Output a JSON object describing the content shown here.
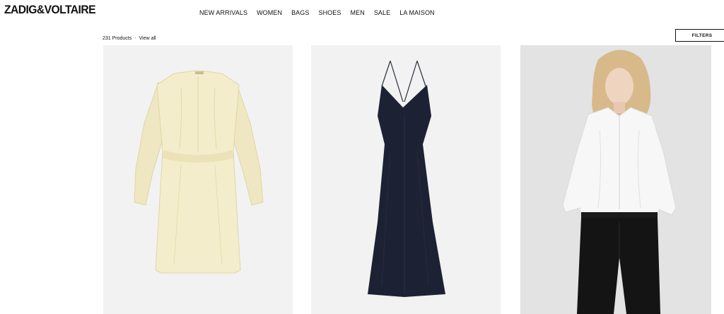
{
  "brand": {
    "logo": "ZADIG&VOLTAIRE"
  },
  "nav": {
    "items": [
      "NEW ARRIVALS",
      "WOMEN",
      "BAGS",
      "SHOES",
      "MEN",
      "SALE",
      "LA MAISON"
    ]
  },
  "listing": {
    "count_label": "231 Products",
    "separator": "-",
    "view_all_label": "View all",
    "filters_label": "FILTERS"
  },
  "products": [
    {
      "image": "cream-long-sleeve-dress",
      "color": "#f3ecc8"
    },
    {
      "image": "navy-slip-dress",
      "color": "#1c2233"
    },
    {
      "image": "model-white-blouse-black-jeans",
      "color": "#ffffff"
    }
  ]
}
